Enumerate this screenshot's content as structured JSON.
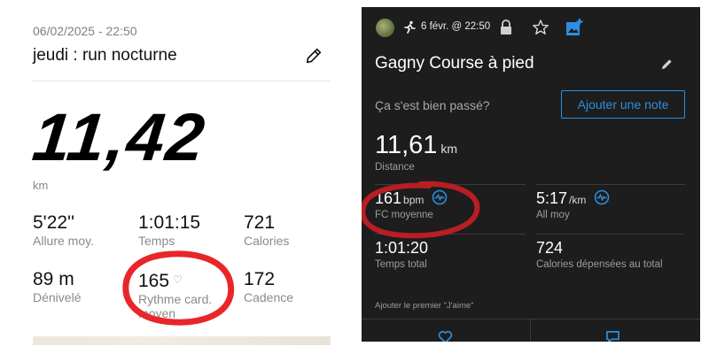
{
  "left": {
    "date": "06/02/2025 - 22:50",
    "title": "jeudi : run nocturne",
    "distance_value": "11,42",
    "distance_unit": "km",
    "stats": [
      {
        "value": "5'22''",
        "label": "Allure moy."
      },
      {
        "value": "1:01:15",
        "label": "Temps"
      },
      {
        "value": "721",
        "label": "Calories"
      },
      {
        "value": "89 m",
        "label": "Dénivelé"
      },
      {
        "value": "165",
        "label": "Rythme card. moyen"
      },
      {
        "value": "172",
        "label": "Cadence"
      }
    ]
  },
  "right": {
    "header_date": "6 févr. @ 22:50",
    "title": "Gagny Course à pied",
    "question": "Ça s'est bien passé?",
    "note_button": "Ajouter une note",
    "distance": {
      "value": "11,61",
      "unit": "km",
      "label": "Distance"
    },
    "hr": {
      "value": "161",
      "unit": "bpm",
      "label": "FC moyenne"
    },
    "pace": {
      "value": "5:17",
      "unit": "/km",
      "label": "All moy"
    },
    "time": {
      "value": "1:01:20",
      "label": "Temps total"
    },
    "calories": {
      "value": "724",
      "label": "Calories dépensées au total"
    },
    "first_like": "Ajouter le premier \"J'aime\""
  },
  "colors": {
    "accent_blue": "#2d8fe0",
    "highlight_red": "#e8262a",
    "dark_bg": "#1d1d1d"
  },
  "icons": [
    "edit-pencil-icon",
    "running-icon",
    "lock-icon",
    "star-icon",
    "add-photo-icon",
    "heart-rate-icon",
    "heart-icon",
    "comment-icon"
  ]
}
